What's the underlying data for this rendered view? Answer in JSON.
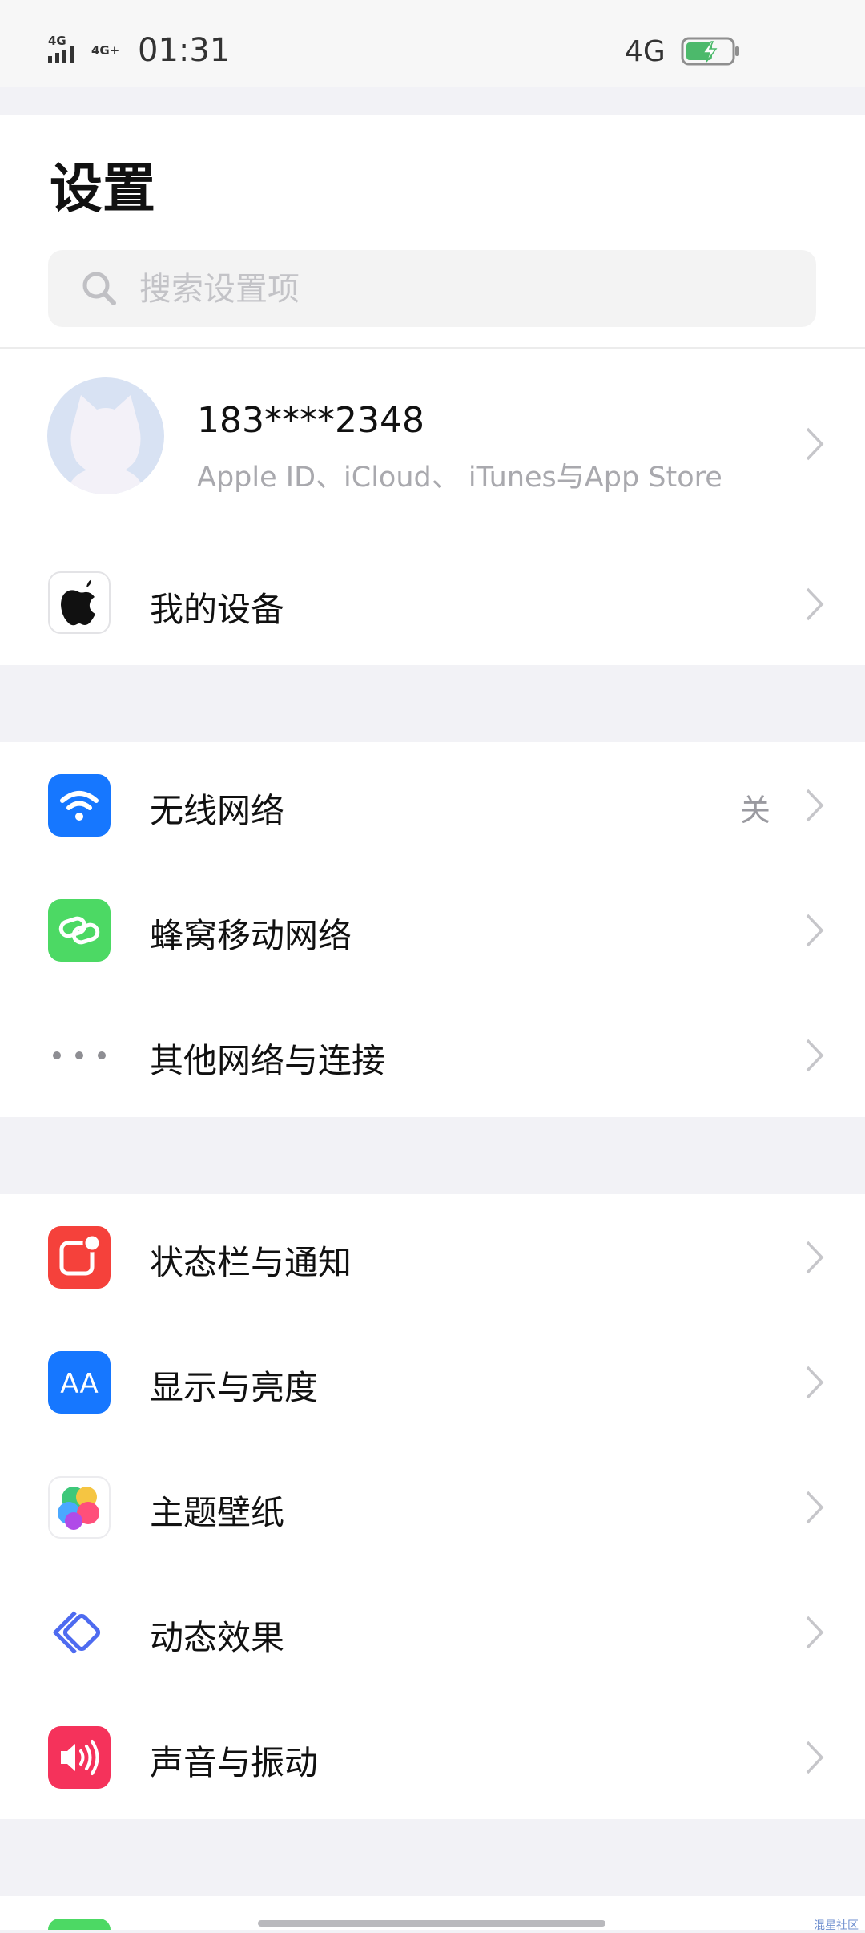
{
  "status_bar": {
    "time": "01:31",
    "signal_left": "4G",
    "signal_right": "4G+",
    "network": "4G",
    "battery_level_pct": 60,
    "battery_color": "#4cb96b"
  },
  "header": {
    "title": "设置",
    "search_placeholder": "搜索设置项"
  },
  "account": {
    "name": "183****2348",
    "subtitle": "Apple ID、iCloud、 iTunes与App Store"
  },
  "device": {
    "label": "我的设备"
  },
  "network_group": {
    "items": [
      {
        "label": "无线网络",
        "value": "关",
        "icon": "wifi-icon",
        "color": "#1677ff"
      },
      {
        "label": "蜂窝移动网络",
        "icon": "cellular-icon",
        "color": "#4cd964"
      },
      {
        "label": "其他网络与连接",
        "icon": "more-dots-icon"
      }
    ]
  },
  "display_group": {
    "items": [
      {
        "label": "状态栏与通知",
        "icon": "notification-icon",
        "color": "#f5413b"
      },
      {
        "label": "显示与亮度",
        "icon": "display-brightness-icon",
        "color": "#1677ff",
        "glyph": "AA"
      },
      {
        "label": "主题壁纸",
        "icon": "theme-wallpaper-icon"
      },
      {
        "label": "动态效果",
        "icon": "motion-effect-icon",
        "color": "#4e6bf0"
      },
      {
        "label": "声音与振动",
        "icon": "sound-icon",
        "color": "#f5325b"
      }
    ]
  },
  "watermark": "混星社区"
}
